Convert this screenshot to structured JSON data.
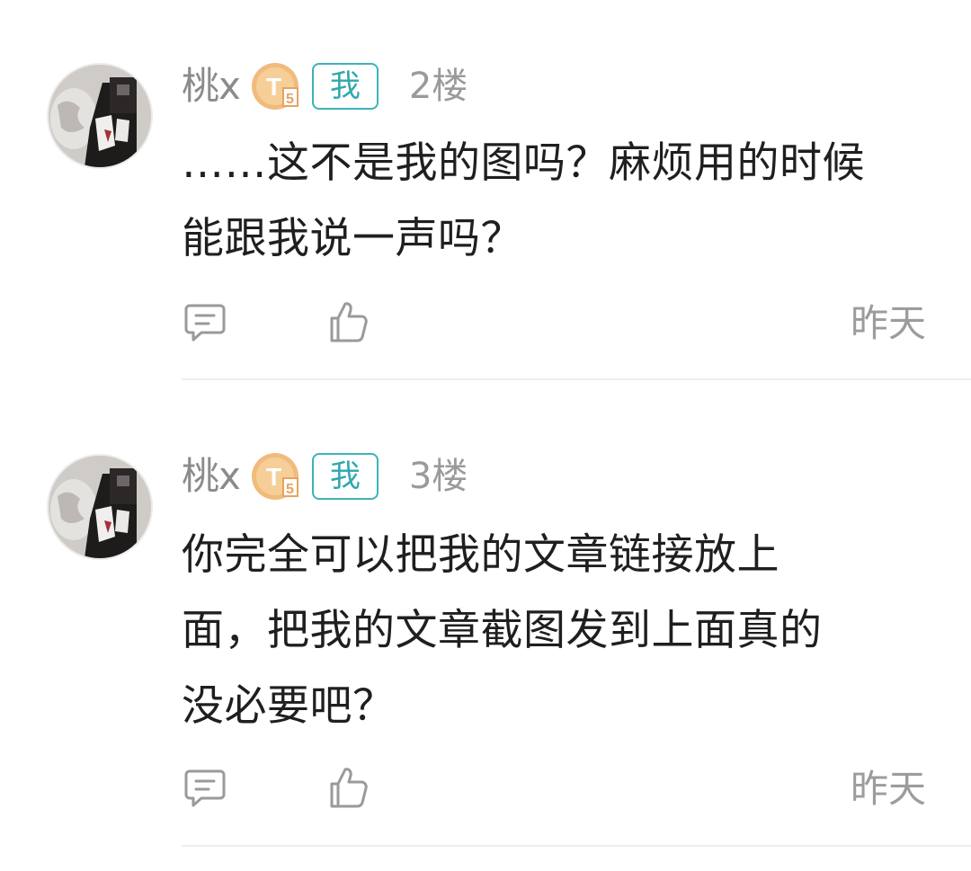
{
  "comments": [
    {
      "username": "桃x",
      "level_badge": "T5",
      "self_tag": "我",
      "floor": "2楼",
      "content": "……这不是我的图吗？麻烦用的时候\n能跟我说一声吗？",
      "timestamp": "昨天",
      "icons": {
        "reply": "comment-bubble-icon",
        "like": "thumbs-up-icon"
      }
    },
    {
      "username": "桃x",
      "level_badge": "T5",
      "self_tag": "我",
      "floor": "3楼",
      "content": "你完全可以把我的文章链接放上\n面，把我的文章截图发到上面真的\n没必要吧？",
      "timestamp": "昨天",
      "icons": {
        "reply": "comment-bubble-icon",
        "like": "thumbs-up-icon"
      }
    }
  ],
  "colors": {
    "username": "#8b8b8b",
    "me_tag": "#3eb3b7",
    "badge": "#f0b070",
    "text": "#1f1f1f",
    "muted": "#9c9c9c",
    "divider": "#eeeeee"
  }
}
